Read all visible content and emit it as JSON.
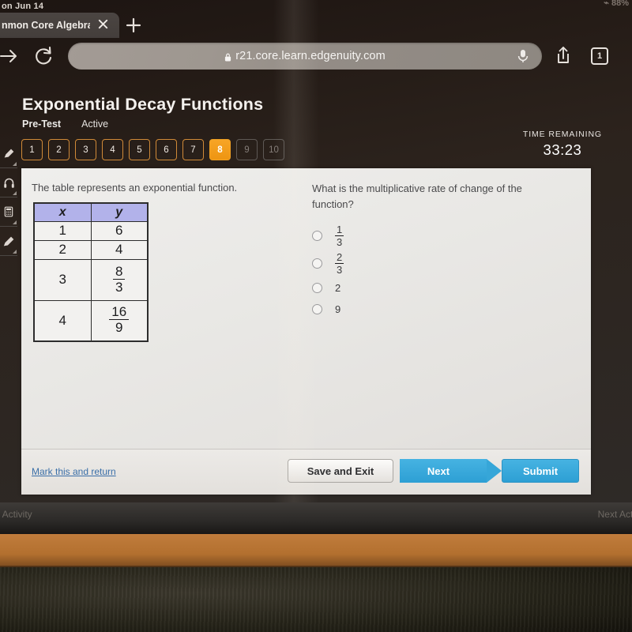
{
  "device": {
    "status_bar_left": "on Jun 14",
    "status_bar_right": "⌁ 88%"
  },
  "browser": {
    "tab_title": "nmon Core Algebra I",
    "close_icon": "close-icon",
    "newtab_icon": "plus-icon",
    "back_forward_icon": "forward-arrow-icon",
    "reload_icon": "reload-icon",
    "url": "r21.core.learn.edgenuity.com",
    "lock_icon": "lock-icon",
    "mic_icon": "microphone-icon",
    "share_icon": "share-icon",
    "tab_count": "1"
  },
  "lesson": {
    "title": "Exponential Decay Functions",
    "assignment_type": "Pre-Test",
    "status": "Active"
  },
  "question_nav": {
    "items": [
      {
        "label": "1",
        "state": "available"
      },
      {
        "label": "2",
        "state": "available"
      },
      {
        "label": "3",
        "state": "available"
      },
      {
        "label": "4",
        "state": "available"
      },
      {
        "label": "5",
        "state": "available"
      },
      {
        "label": "6",
        "state": "available"
      },
      {
        "label": "7",
        "state": "available"
      },
      {
        "label": "8",
        "state": "current"
      },
      {
        "label": "9",
        "state": "locked"
      },
      {
        "label": "10",
        "state": "locked"
      }
    ]
  },
  "timer": {
    "label": "TIME REMAINING",
    "value": "33:23"
  },
  "tools": {
    "items": [
      {
        "name": "highlighter-icon"
      },
      {
        "name": "headphones-icon"
      },
      {
        "name": "calculator-icon"
      },
      {
        "name": "pencil-icon"
      }
    ]
  },
  "content": {
    "prompt": "The table represents an exponential function.",
    "table": {
      "headers": [
        "x",
        "y"
      ],
      "rows": [
        {
          "x": "1",
          "y_type": "plain",
          "y": "6"
        },
        {
          "x": "2",
          "y_type": "plain",
          "y": "4"
        },
        {
          "x": "3",
          "y_type": "fraction",
          "num": "8",
          "den": "3"
        },
        {
          "x": "4",
          "y_type": "fraction",
          "num": "16",
          "den": "9"
        }
      ]
    },
    "question": "What is the multiplicative rate of change of the function?",
    "choices": [
      {
        "id": "a",
        "type": "fraction",
        "num": "1",
        "den": "3",
        "selected": false
      },
      {
        "id": "b",
        "type": "fraction",
        "num": "2",
        "den": "3",
        "selected": false
      },
      {
        "id": "c",
        "type": "plain",
        "label": "2",
        "selected": false
      },
      {
        "id": "d",
        "type": "plain",
        "label": "9",
        "selected": false
      }
    ]
  },
  "footer": {
    "mark_link": "Mark this and return",
    "save_label": "Save and Exit",
    "next_label": "Next",
    "submit_label": "Submit"
  },
  "activity_bar": {
    "previous": "s Activity",
    "next": "Next Acti"
  },
  "colors": {
    "accent_orange": "#f5a01e",
    "accent_blue": "#2d9fd4",
    "table_header": "#b2b2ea",
    "link_blue": "#3a6fa8"
  }
}
